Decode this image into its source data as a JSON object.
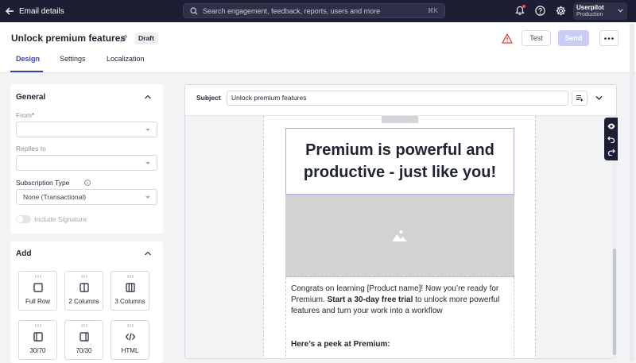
{
  "topbar": {
    "title": "Email details",
    "search_placeholder": "Search engagement, feedback, reports, users and more",
    "search_shortcut": "⌘K",
    "account_name": "Userpilot",
    "account_env": "Production"
  },
  "header": {
    "title": "Unlock premium features",
    "status_badge": "Draft",
    "test_label": "Test",
    "send_label": "Send",
    "tabs": [
      {
        "label": "Design",
        "active": true
      },
      {
        "label": "Settings",
        "active": false
      },
      {
        "label": "Localization",
        "active": false
      }
    ]
  },
  "general": {
    "title": "General",
    "from_label": "From",
    "from_required": "*",
    "from_value": "",
    "replies_label": "Replies to",
    "replies_value": "",
    "subscription_label": "Subscription Type",
    "subscription_value": "None (Transactional)",
    "signature_label": "Include Signature"
  },
  "add": {
    "title": "Add",
    "tiles": [
      {
        "label": "Full Row",
        "icon": "full-row-icon"
      },
      {
        "label": "2 Columns",
        "icon": "two-columns-icon"
      },
      {
        "label": "3 Columns",
        "icon": "three-columns-icon"
      },
      {
        "label": "30/70",
        "icon": "split-30-70-icon"
      },
      {
        "label": "70/30",
        "icon": "split-70-30-icon"
      },
      {
        "label": "HTML",
        "icon": "code-icon"
      }
    ]
  },
  "editor": {
    "subject_label": "Subject",
    "subject_value": "Unlock premium features",
    "headline": "Premium is powerful and productive - just like you!",
    "body_pre": "Congrats on learning [Product name]! Now you’re ready for Premium. ",
    "body_bold": "Start a 30-day free trial",
    "body_post": " to unlock more powerful features and turn your work into a workflow",
    "peek": "Here’s a peek at Premium:"
  },
  "colors": {
    "topbar_bg": "#1c1f33",
    "accent": "#3a3fb8",
    "send_disabled": "#c9cdf5",
    "warning": "#e23b3b"
  }
}
